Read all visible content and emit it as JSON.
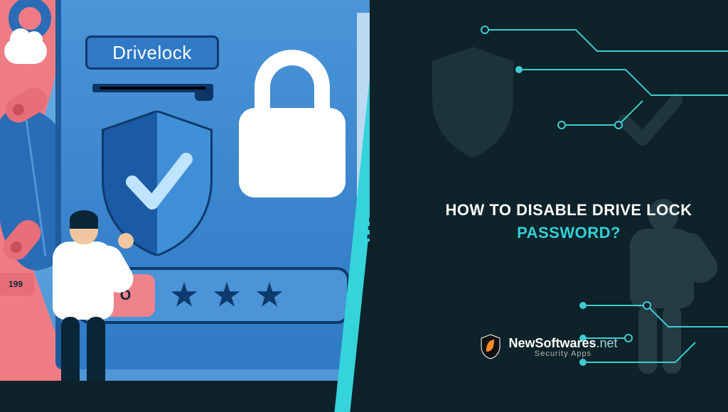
{
  "illustration": {
    "book_title": "Drivelock",
    "password_box_text": "I O",
    "badge_text": "199"
  },
  "headline": {
    "line1": "HOW TO DISABLE DRIVE LOCK",
    "line2_accent": "PASSWORD?"
  },
  "brand": {
    "name": "NewSoftwares",
    "domain": ".net",
    "tagline": "Security Apps"
  },
  "colors": {
    "accent": "#32cfd5",
    "dark": "#0d2229",
    "blue": "#2f79c6",
    "pink": "#ef7c84"
  }
}
